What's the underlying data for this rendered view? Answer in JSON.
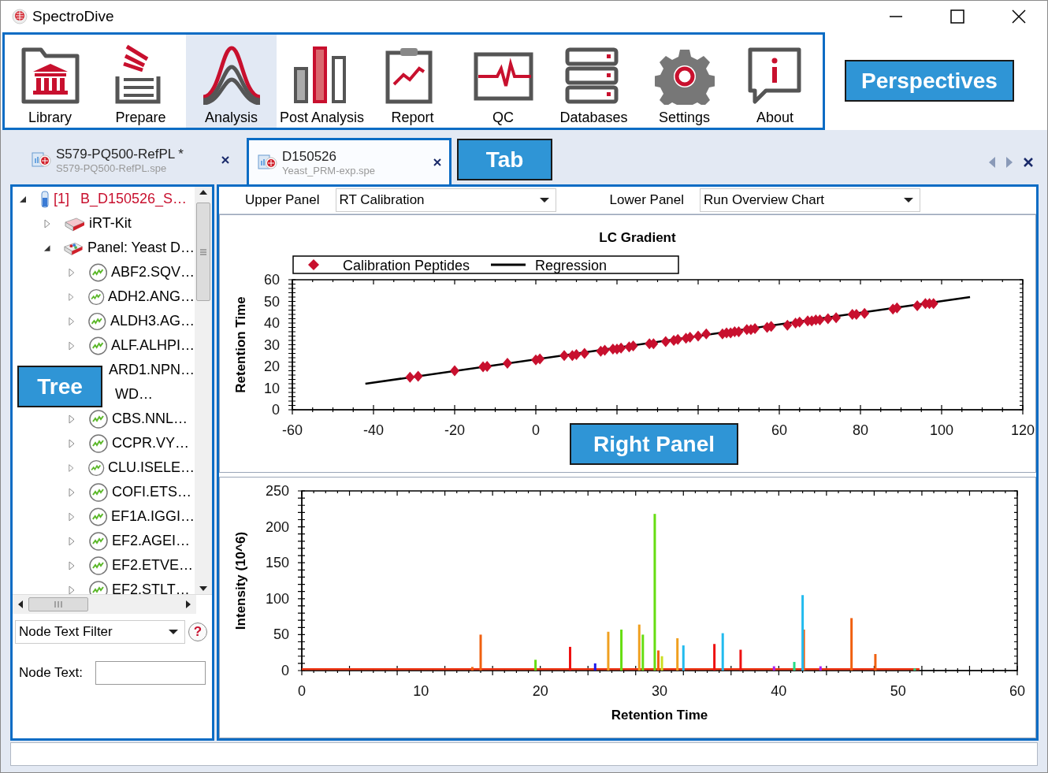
{
  "window": {
    "title": "SpectroDive"
  },
  "perspectives": [
    {
      "label": "Library",
      "selected": false
    },
    {
      "label": "Prepare",
      "selected": false
    },
    {
      "label": "Analysis",
      "selected": true
    },
    {
      "label": "Post Analysis",
      "selected": false
    },
    {
      "label": "Report",
      "selected": false
    },
    {
      "label": "QC",
      "selected": false
    },
    {
      "label": "Databases",
      "selected": false
    },
    {
      "label": "Settings",
      "selected": false
    },
    {
      "label": "About",
      "selected": false
    }
  ],
  "tabs": [
    {
      "title": "S579-PQ500-RefPL *",
      "file": "S579-PQ500-RefPL.spe",
      "selected": false
    },
    {
      "title": "D150526",
      "file": "Yeast_PRM-exp.spe",
      "selected": true
    }
  ],
  "tree": {
    "kind": "sample",
    "index": "[1]",
    "label": "B_D150526_S…",
    "expanded": true,
    "children": [
      {
        "kind": "kit",
        "label": "iRT-Kit",
        "expanded": false
      },
      {
        "kind": "panel",
        "label": "Panel: Yeast D…",
        "expanded": true,
        "children": [
          {
            "kind": "peptide",
            "label": "ABF2.SQV…",
            "expanded": false
          },
          {
            "kind": "peptide",
            "label": "ADH2.ANG…",
            "expanded": false
          },
          {
            "kind": "peptide",
            "label": "ALDH3.AG…",
            "expanded": false
          },
          {
            "kind": "peptide",
            "label": "ALF.ALHPI…",
            "expanded": false
          },
          {
            "kind": "peptide",
            "label": "ARD1.NPN…",
            "covered": true
          },
          {
            "kind": "peptide",
            "label": "WD…",
            "covered": true
          },
          {
            "kind": "peptide",
            "label": "CBS.NNL…",
            "expanded": false
          },
          {
            "kind": "peptide",
            "label": "CCPR.VY…",
            "expanded": false
          },
          {
            "kind": "peptide",
            "label": "CLU.ISELE…",
            "expanded": false
          },
          {
            "kind": "peptide",
            "label": "COFI.ETS…",
            "expanded": false
          },
          {
            "kind": "peptide",
            "label": "EF1A.IGGI…",
            "expanded": false
          },
          {
            "kind": "peptide",
            "label": "EF2.AGEI…",
            "expanded": false
          },
          {
            "kind": "peptide",
            "label": "EF2.ETVE…",
            "expanded": false
          },
          {
            "kind": "peptide",
            "label": "EF2.STLT…",
            "expanded": false
          }
        ]
      }
    ]
  },
  "filter": {
    "value": "Node Text Filter",
    "help_glyph": "?",
    "node_text_label": "Node Text:"
  },
  "right_panel": {
    "upper_label": "Upper Panel",
    "upper_value": "RT Calibration",
    "lower_label": "Lower Panel",
    "lower_value": "Run Overview Chart",
    "upper_chart": {
      "chart_data": {
        "type": "scatter",
        "title": "LC Gradient",
        "ylabel": "Retention Time",
        "xlim": [
          -60,
          120
        ],
        "ylim": [
          0,
          60
        ],
        "xticks": [
          -60,
          -40,
          -20,
          0,
          60,
          80,
          100,
          120
        ],
        "yticks": [
          0,
          10,
          20,
          30,
          40,
          50,
          60
        ],
        "legend": true,
        "series": [
          {
            "name": "Calibration Peptides",
            "color": "#c8102e",
            "x": [
              -31,
              -29,
              -20,
              -13,
              -12,
              -7,
              0,
              1,
              7,
              9,
              10,
              12,
              16,
              17,
              19,
              20,
              21,
              23,
              24,
              28,
              29,
              32,
              34,
              35,
              37,
              38,
              40,
              42,
              46,
              47,
              48,
              49,
              50,
              52,
              53,
              54,
              57,
              58,
              62,
              64,
              65,
              67,
              68,
              69,
              70,
              72,
              74,
              78,
              79,
              81,
              88,
              89,
              94,
              96,
              97,
              98
            ],
            "values": [
              15,
              15.5,
              18,
              19.8,
              20,
              21.5,
              23,
              23.5,
              25,
              25,
              25.5,
              26,
              27,
              27.5,
              28,
              28,
              28.5,
              29,
              29.5,
              30.5,
              30.5,
              31.5,
              32,
              32.5,
              33,
              33.5,
              34,
              35,
              35,
              35.5,
              35.5,
              36,
              36,
              37,
              37,
              37.5,
              38,
              38.5,
              39,
              40,
              40.5,
              41,
              41,
              41.5,
              41.5,
              42,
              42.5,
              44,
              44,
              44.5,
              46.5,
              47,
              48,
              49,
              49,
              49
            ]
          },
          {
            "name": "Regression",
            "type": "line",
            "color": "#000000",
            "x": [
              -42,
              107
            ],
            "values": [
              12,
              52
            ]
          }
        ]
      }
    },
    "lower_chart": {
      "chart_data": {
        "type": "bar",
        "xlabel": "Retention Time",
        "ylabel": "Intensity (10^6)",
        "xlim": [
          0,
          60
        ],
        "ylim": [
          0,
          250
        ],
        "xticks": [
          0,
          10,
          20,
          30,
          40,
          50,
          60
        ],
        "yticks": [
          0,
          50,
          100,
          150,
          200,
          250
        ],
        "x": [
          14.3,
          15.0,
          19.6,
          22.5,
          24.6,
          25.7,
          26.8,
          28.3,
          28.6,
          29.6,
          29.9,
          30.2,
          31.5,
          32.0,
          34.6,
          35.3,
          36.8,
          39.6,
          41.3,
          42.0,
          42.1,
          43.5,
          46.1,
          48.1,
          51.4
        ],
        "series": [
          {
            "type": "line",
            "color": "#ee3311",
            "x": [
              0,
              51.8
            ],
            "values": [
              2,
              2
            ]
          },
          {
            "color": "#f06010",
            "values": [
              5,
              50,
              null,
              null,
              null,
              null,
              null,
              null,
              null,
              null,
              28,
              null,
              null,
              null,
              null,
              null,
              null,
              null,
              null,
              null,
              57,
              null,
              73,
              23,
              null
            ]
          },
          {
            "color": "#66dd11",
            "values": [
              null,
              null,
              15,
              null,
              null,
              null,
              57,
              null,
              50,
              218,
              null,
              null,
              null,
              null,
              null,
              null,
              null,
              null,
              null,
              null,
              null,
              null,
              null,
              null,
              null
            ]
          },
          {
            "color": "#ee1111",
            "values": [
              null,
              null,
              null,
              33,
              null,
              null,
              null,
              null,
              null,
              null,
              null,
              null,
              null,
              null,
              37,
              null,
              29,
              null,
              null,
              null,
              null,
              null,
              null,
              null,
              null
            ]
          },
          {
            "color": "#1a1aee",
            "values": [
              null,
              null,
              null,
              null,
              10,
              null,
              null,
              null,
              null,
              null,
              null,
              null,
              null,
              null,
              null,
              null,
              null,
              null,
              null,
              null,
              null,
              null,
              null,
              null,
              null
            ]
          },
          {
            "color": "#f0a020",
            "values": [
              null,
              null,
              null,
              null,
              null,
              54,
              null,
              64,
              null,
              null,
              null,
              null,
              45,
              null,
              null,
              null,
              null,
              null,
              null,
              null,
              null,
              null,
              null,
              null,
              null
            ]
          },
          {
            "color": "#ccdd22",
            "values": [
              null,
              null,
              null,
              null,
              null,
              null,
              null,
              null,
              null,
              null,
              null,
              20,
              null,
              null,
              null,
              null,
              null,
              null,
              null,
              null,
              null,
              null,
              null,
              null,
              null
            ]
          },
          {
            "color": "#22bbee",
            "values": [
              null,
              null,
              null,
              null,
              null,
              null,
              null,
              null,
              null,
              null,
              null,
              null,
              null,
              35,
              null,
              52,
              null,
              null,
              null,
              105,
              null,
              null,
              null,
              null,
              null
            ]
          },
          {
            "color": "#aa22ee",
            "values": [
              null,
              null,
              null,
              null,
              null,
              null,
              null,
              null,
              null,
              null,
              null,
              null,
              null,
              null,
              null,
              null,
              null,
              6,
              null,
              null,
              null,
              6,
              null,
              null,
              null
            ]
          },
          {
            "color": "#22dd88",
            "values": [
              null,
              null,
              null,
              null,
              null,
              null,
              null,
              null,
              null,
              null,
              null,
              null,
              null,
              null,
              null,
              null,
              null,
              null,
              12,
              null,
              null,
              null,
              null,
              null,
              3
            ]
          }
        ]
      }
    }
  },
  "callouts": [
    {
      "text": "Perspectives"
    },
    {
      "text": "Tab"
    },
    {
      "text": "Tree"
    },
    {
      "text": "Right Panel"
    }
  ]
}
